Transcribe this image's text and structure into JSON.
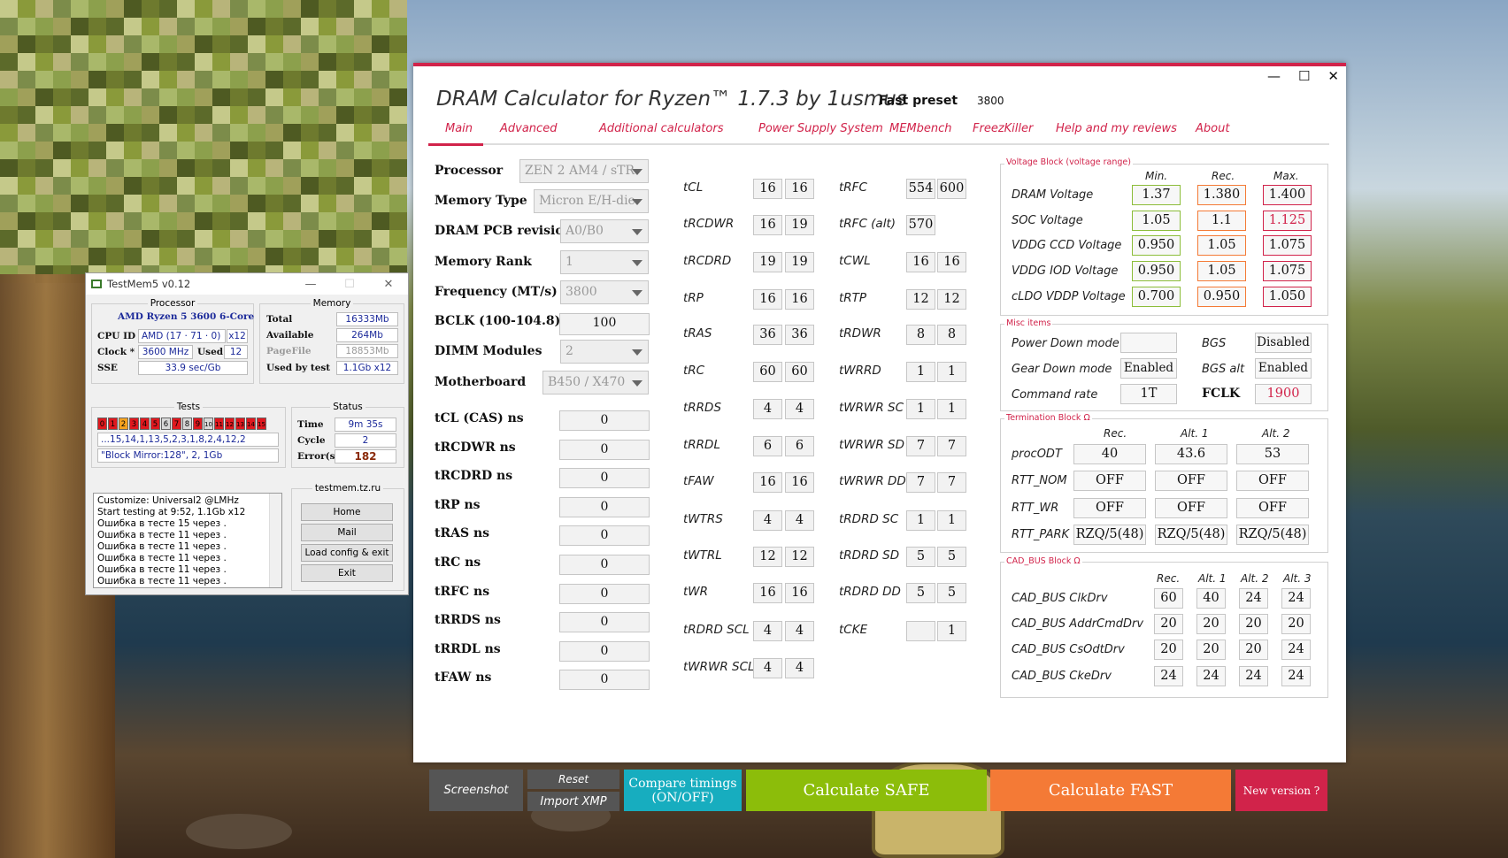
{
  "colors": {
    "accent": "#d1234a",
    "safe": "#8cbd0a",
    "fast": "#f47a36",
    "teal": "#17adbf",
    "dark": "#555555",
    "min": "#8cbd3a",
    "rec": "#f47a36",
    "max": "#d1234a"
  },
  "testmem": {
    "title": "TestMem5 v0.12",
    "processor_legend": "Processor",
    "cpu_name": "AMD Ryzen 5 3600 6-Core",
    "cpu_id_label": "CPU ID",
    "cpu_id": "AMD  (17 · 71 · 0)",
    "threads": "x12",
    "clock_label": "Clock *",
    "clock": "3600 MHz",
    "used_label": "Used",
    "used": "12",
    "sse_label": "SSE",
    "sse": "33.9 sec/Gb",
    "memory_legend": "Memory",
    "total_label": "Total",
    "total": "16333Mb",
    "available_label": "Available",
    "available": "264Mb",
    "pagefile_label": "PageFile",
    "pagefile": "18853Mb",
    "usedtest_label": "Used by test",
    "usedtest": "1.1Gb x12",
    "tests_legend": "Tests",
    "test_cells": [
      "0",
      "1",
      "2",
      "3",
      "4",
      "5",
      "6",
      "7",
      "8",
      "9",
      "10",
      "11",
      "12",
      "13",
      "14",
      "15"
    ],
    "test_seq": "...15,14,1,13,5,2,3,1,8,2,4,12,2",
    "test_cfg": "\"Block Mirror:128\", 2, 1Gb",
    "status_legend": "Status",
    "time_label": "Time",
    "time": "9m 35s",
    "cycle_label": "Cycle",
    "cycle": "2",
    "errors_label": "Error(s)",
    "errors": "182",
    "site_legend": "testmem.tz.ru",
    "log": [
      "Customize: Universal2 @LMHz",
      "Start testing at 9:52, 1.1Gb x12",
      "Ошибка в тесте 15 через .",
      "Ошибка в тесте 11 через .",
      "Ошибка в тесте 11 через .",
      "Ошибка в тесте 11 через .",
      "Ошибка в тесте 11 через .",
      "Ошибка в тесте 11 через ."
    ],
    "buttons": [
      "Home",
      "Mail",
      "Load config & exit",
      "Exit"
    ]
  },
  "app": {
    "title": "DRAM Calculator for Ryzen™ 1.7.3 by 1usmus",
    "preset_label": "Fast preset",
    "preset_value": "3800",
    "tabs": [
      "Main",
      "Advanced",
      "Additional calculators",
      "Power Supply System",
      "MEMbench",
      "FreezKiller",
      "Help and my reviews",
      "About"
    ],
    "left": {
      "processor_label": "Processor",
      "processor": "ZEN 2 AM4 / sTR",
      "memtype_label": "Memory Type",
      "memtype": "Micron E/H-die",
      "pcb_label": "DRAM PCB revision",
      "pcb": "A0/B0",
      "rank_label": "Memory Rank",
      "rank": "1",
      "freq_label": "Frequency (MT/s)",
      "freq": "3800",
      "bclk_label": "BCLK (100-104.8)",
      "bclk": "100",
      "dimm_label": "DIMM Modules",
      "dimm": "2",
      "mb_label": "Motherboard",
      "mb": "B450 / X470",
      "ns": [
        {
          "label": "tCL (CAS) ns",
          "value": "0"
        },
        {
          "label": "tRCDWR ns",
          "value": "0"
        },
        {
          "label": "tRCDRD ns",
          "value": "0"
        },
        {
          "label": "tRP ns",
          "value": "0"
        },
        {
          "label": "tRAS ns",
          "value": "0"
        },
        {
          "label": "tRC ns",
          "value": "0"
        },
        {
          "label": "tRFC ns",
          "value": "0"
        },
        {
          "label": "tRRDS ns",
          "value": "0"
        },
        {
          "label": "tRRDL ns",
          "value": "0"
        },
        {
          "label": "tFAW ns",
          "value": "0"
        }
      ]
    },
    "timings_a": [
      {
        "name": "tCL",
        "a": "16",
        "b": "16"
      },
      {
        "name": "tRCDWR",
        "a": "16",
        "b": "19"
      },
      {
        "name": "tRCDRD",
        "a": "19",
        "b": "19"
      },
      {
        "name": "tRP",
        "a": "16",
        "b": "16"
      },
      {
        "name": "tRAS",
        "a": "36",
        "b": "36"
      },
      {
        "name": "tRC",
        "a": "60",
        "b": "60"
      },
      {
        "name": "tRRDS",
        "a": "4",
        "b": "4"
      },
      {
        "name": "tRRDL",
        "a": "6",
        "b": "6"
      },
      {
        "name": "tFAW",
        "a": "16",
        "b": "16"
      },
      {
        "name": "tWTRS",
        "a": "4",
        "b": "4"
      },
      {
        "name": "tWTRL",
        "a": "12",
        "b": "12"
      },
      {
        "name": "tWR",
        "a": "16",
        "b": "16"
      },
      {
        "name": "tRDRD SCL",
        "a": "4",
        "b": "4"
      },
      {
        "name": "tWRWR SCL",
        "a": "4",
        "b": "4"
      }
    ],
    "timings_b": [
      {
        "name": "tRFC",
        "a": "554",
        "b": "600"
      },
      {
        "name": "tRFC (alt)",
        "a": "570",
        "b": ""
      },
      {
        "name": "tCWL",
        "a": "16",
        "b": "16"
      },
      {
        "name": "tRTP",
        "a": "12",
        "b": "12"
      },
      {
        "name": "tRDWR",
        "a": "8",
        "b": "8"
      },
      {
        "name": "tWRRD",
        "a": "1",
        "b": "1"
      },
      {
        "name": "tWRWR SC",
        "a": "1",
        "b": "1"
      },
      {
        "name": "tWRWR SD",
        "a": "7",
        "b": "7"
      },
      {
        "name": "tWRWR DD",
        "a": "7",
        "b": "7"
      },
      {
        "name": "tRDRD SC",
        "a": "1",
        "b": "1"
      },
      {
        "name": "tRDRD SD",
        "a": "5",
        "b": "5"
      },
      {
        "name": "tRDRD DD",
        "a": "5",
        "b": "5"
      },
      {
        "name": "tCKE",
        "a": "",
        "b": "1"
      }
    ],
    "voltage": {
      "title": "Voltage Block (voltage range)",
      "h_min": "Min.",
      "h_rec": "Rec.",
      "h_max": "Max.",
      "rows": [
        {
          "label": "DRAM Voltage",
          "min": "1.37",
          "rec": "1.380",
          "max": "1.400"
        },
        {
          "label": "SOC Voltage",
          "min": "1.05",
          "rec": "1.1",
          "max": "1.125"
        },
        {
          "label": "VDDG  CCD Voltage",
          "min": "0.950",
          "rec": "1.05",
          "max": "1.075"
        },
        {
          "label": "VDDG  IOD Voltage",
          "min": "0.950",
          "rec": "1.05",
          "max": "1.075"
        },
        {
          "label": "cLDO VDDP Voltage",
          "min": "0.700",
          "rec": "0.950",
          "max": "1.050"
        }
      ]
    },
    "misc": {
      "title": "Misc items",
      "pd_label": "Power Down mode",
      "pd": "",
      "bgs_label": "BGS",
      "bgs": "Disabled",
      "gd_label": "Gear Down mode",
      "gd": "Enabled",
      "bgsalt_label": "BGS alt",
      "bgsalt": "Enabled",
      "cr_label": "Command rate",
      "cr": "1T",
      "fclk_label": "FCLK",
      "fclk": "1900"
    },
    "term": {
      "title": "Termination Block Ω",
      "h_rec": "Rec.",
      "h_alt1": "Alt. 1",
      "h_alt2": "Alt. 2",
      "rows": [
        {
          "label": "procODT",
          "rec": "40",
          "alt1": "43.6",
          "alt2": "53"
        },
        {
          "label": "RTT_NOM",
          "rec": "OFF",
          "alt1": "OFF",
          "alt2": "OFF"
        },
        {
          "label": "RTT_WR",
          "rec": "OFF",
          "alt1": "OFF",
          "alt2": "OFF"
        },
        {
          "label": "RTT_PARK",
          "rec": "RZQ/5(48)",
          "alt1": "RZQ/5(48)",
          "alt2": "RZQ/5(48)"
        }
      ]
    },
    "cad": {
      "title": "CAD_BUS Block Ω",
      "h_rec": "Rec.",
      "h_alt1": "Alt. 1",
      "h_alt2": "Alt. 2",
      "h_alt3": "Alt. 3",
      "rows": [
        {
          "label": "CAD_BUS ClkDrv",
          "v": [
            "60",
            "40",
            "24",
            "24"
          ]
        },
        {
          "label": "CAD_BUS AddrCmdDrv",
          "v": [
            "20",
            "20",
            "20",
            "20"
          ]
        },
        {
          "label": "CAD_BUS CsOdtDrv",
          "v": [
            "20",
            "20",
            "20",
            "24"
          ]
        },
        {
          "label": "CAD_BUS CkeDrv",
          "v": [
            "24",
            "24",
            "24",
            "24"
          ]
        }
      ]
    },
    "buttons": {
      "screenshot": "Screenshot",
      "reset": "Reset",
      "import": "Import XMP",
      "compare": "Compare timings",
      "compare2": "(ON/OFF)",
      "safe": "Calculate SAFE",
      "fast": "Calculate FAST",
      "newver": "New version ?"
    }
  }
}
